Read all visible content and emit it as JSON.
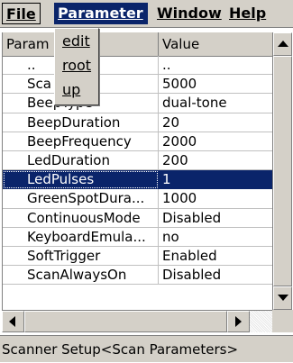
{
  "menubar": {
    "file": "File",
    "parameter": "Parameter",
    "window": "Window",
    "help": "Help"
  },
  "dropdown": {
    "items": [
      {
        "label": "edit"
      },
      {
        "label": "root"
      },
      {
        "label": "up"
      }
    ]
  },
  "grid": {
    "headers": {
      "parameter": "Param",
      "value": "Value"
    },
    "rows": [
      {
        "name": "..",
        "value": ".."
      },
      {
        "name": "Sca",
        "value": "5000"
      },
      {
        "name": "BeepType",
        "value": "dual-tone"
      },
      {
        "name": "BeepDuration",
        "value": "20"
      },
      {
        "name": "BeepFrequency",
        "value": "2000"
      },
      {
        "name": "LedDuration",
        "value": "200"
      },
      {
        "name": "LedPulses",
        "value": "1"
      },
      {
        "name": "GreenSpotDura...",
        "value": "1000"
      },
      {
        "name": "ContinuousMode",
        "value": "Disabled"
      },
      {
        "name": "KeyboardEmula...",
        "value": "no"
      },
      {
        "name": "SoftTrigger",
        "value": "Enabled"
      },
      {
        "name": "ScanAlwaysOn",
        "value": "Disabled"
      }
    ],
    "selected_row": "LedPulses"
  },
  "statusbar": {
    "text": "Scanner Setup<Scan Parameters>"
  },
  "colors": {
    "selection": "#0a246a",
    "chrome": "#d4d0c8"
  }
}
